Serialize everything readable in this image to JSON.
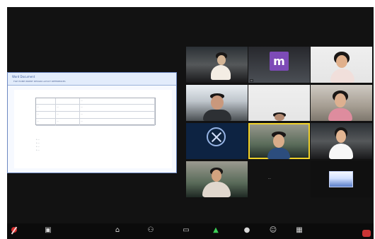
{
  "meeting": {
    "share": {
      "title": "Word Document",
      "menu": "FILE HOME INSERT DESIGN LAYOUT REFERENCES",
      "table": {
        "rows": [
          [
            "",
            "",
            "..."
          ],
          [
            "...",
            "...",
            "..."
          ],
          [
            "...",
            "...",
            "..."
          ],
          [
            "...",
            "...",
            "..."
          ]
        ]
      },
      "notes": "• ...\n• ...\n• ...\n• ..."
    },
    "participants": [
      {
        "label": "",
        "style": "bg-room-1"
      },
      {
        "label": "m",
        "style": "bg-room-4",
        "avatar": "m"
      },
      {
        "label": "",
        "style": "bg-room-6"
      },
      {
        "label": "",
        "style": "bg-room-2"
      },
      {
        "label": "",
        "style": "bg-room-6"
      },
      {
        "label": "",
        "style": "bg-room-3"
      },
      {
        "label": "",
        "style": "bg-room-logo"
      },
      {
        "label": "",
        "style": "bg-room-5",
        "highlight": true
      },
      {
        "label": "",
        "style": "bg-room-1"
      },
      {
        "label": "",
        "style": "bg-room-5"
      },
      {
        "label": "...",
        "style": "bg-room-dark"
      },
      {
        "label": "",
        "style": "bg-room-thumb"
      }
    ],
    "toolbar": {
      "items": [
        "mute",
        "video",
        "security",
        "participants",
        "chat",
        "share",
        "record",
        "reactions",
        "apps",
        "more",
        "end"
      ]
    },
    "colors": {
      "accent": "#f0d22b",
      "mute": "#d42d2d",
      "share": "#3ccf56",
      "end": "#ca3434"
    }
  }
}
